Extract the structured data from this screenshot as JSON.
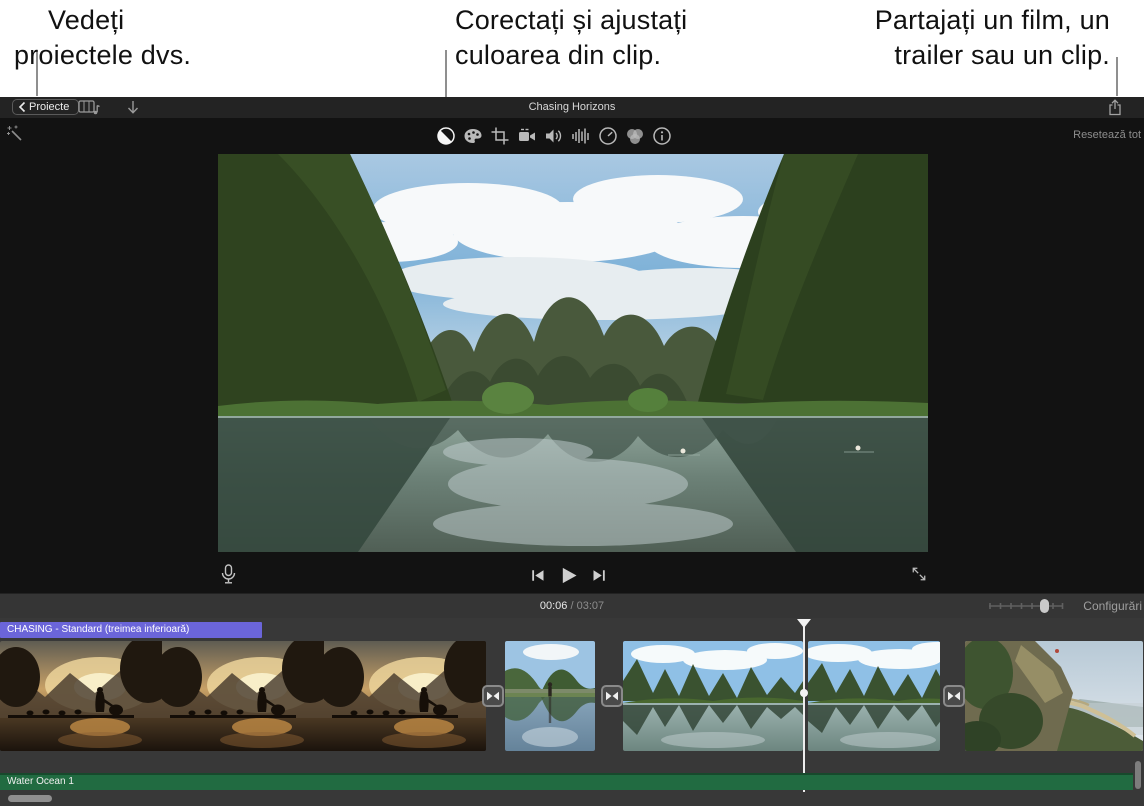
{
  "callouts": {
    "projects": {
      "line1": "Vedeți",
      "line2": "proiectele dvs."
    },
    "color": {
      "line1": "Corectați și ajustați",
      "line2": "culoarea din clip."
    },
    "share": {
      "line1": "Partajați un film, un",
      "line2": "trailer sau un clip."
    }
  },
  "toolbar": {
    "back_label": "Proiecte",
    "project_title": "Chasing Horizons",
    "icons": [
      "back-chevron",
      "media-library",
      "import-down-arrow",
      "share"
    ]
  },
  "adjust_bar": {
    "reset_all_label": "Resetează tot",
    "icons": [
      "auto-enhance-wand",
      "color-balance",
      "color-palette",
      "crop",
      "stabilization",
      "volume",
      "noise-reduction",
      "speed",
      "filters",
      "clip-info"
    ]
  },
  "transport": {
    "icons": [
      "microphone",
      "skip-back",
      "play",
      "skip-forward",
      "fullscreen"
    ]
  },
  "timeline_header": {
    "current_time": "00:06",
    "time_separator": " / ",
    "total_time": "03:07",
    "settings_label": "Configurări"
  },
  "timeline": {
    "title_clip_label": "CHASING - Standard (treimea inferioară)",
    "audio_clip_label": "Water Ocean 1"
  },
  "colors": {
    "title_clip_bg": "#6b65d9",
    "audio_clip_bg": "#216b41",
    "topbar_bg": "#232323",
    "viewer_bg": "#121212",
    "timeline_bg": "#383838",
    "callout_text": "#111111"
  }
}
